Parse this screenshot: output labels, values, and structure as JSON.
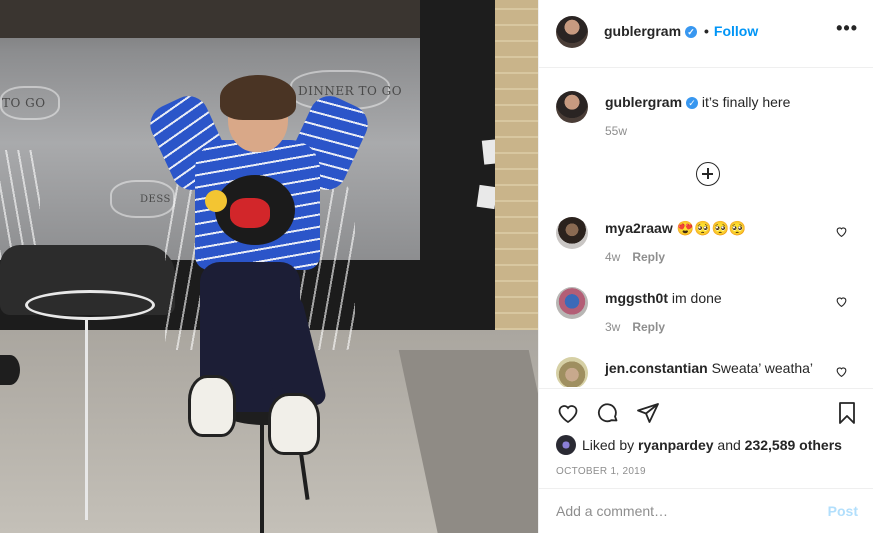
{
  "post": {
    "username": "gublergram",
    "follow_label": "Follow",
    "dot": "•",
    "more": "•••",
    "photo": {
      "sign_labels": [
        "TO GO",
        "DINNER TO GO",
        "DESS"
      ]
    }
  },
  "caption": {
    "username": "gublergram",
    "text": "it’s finally here",
    "time": "55w"
  },
  "comments": [
    {
      "username": "mya2raaw",
      "text": "😍🥺🥺🥺",
      "time": "4w",
      "reply": "Reply"
    },
    {
      "username": "mggsth0t",
      "text": "im done",
      "time": "3w",
      "reply": "Reply"
    },
    {
      "username": "jen.constantian",
      "text": "Sweata’ weatha’",
      "time": "",
      "reply": ""
    }
  ],
  "likes": {
    "prefix": "Liked by",
    "user": "ryanpardey",
    "middle": "and",
    "count": "232,589 others"
  },
  "date": "OCTOBER 1, 2019",
  "add_comment": {
    "placeholder": "Add a comment…",
    "post_label": "Post"
  },
  "colors": {
    "accent": "#0095f6",
    "verified": "#3897f0",
    "muted": "#8e8e8e",
    "post_disabled": "#b2dffc"
  },
  "icons": [
    "heart-icon",
    "comment-icon",
    "share-icon",
    "bookmark-icon",
    "verified-badge-icon",
    "more-options-icon",
    "load-more-comments-icon"
  ]
}
